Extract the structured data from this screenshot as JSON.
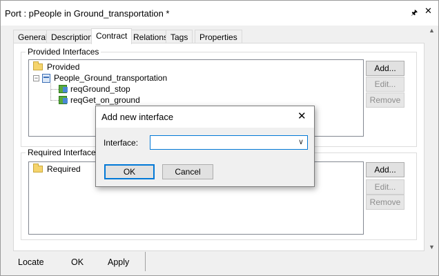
{
  "window": {
    "title": "Port : pPeople in Ground_transportation *",
    "pin_icon": "pin-icon",
    "close_icon": "close-icon"
  },
  "tabs": [
    {
      "label": "General"
    },
    {
      "label": "Description"
    },
    {
      "label": "Contract"
    },
    {
      "label": "Relations"
    },
    {
      "label": "Tags"
    },
    {
      "label": "Properties"
    }
  ],
  "active_tab": "Contract",
  "provided": {
    "group_label": "Provided Interfaces",
    "root_label": "Provided",
    "interface_label": "People_Ground_transportation",
    "operations": [
      "reqGround_stop",
      "reqGet_on_ground"
    ],
    "buttons": {
      "add": "Add...",
      "edit": "Edit...",
      "remove": "Remove"
    }
  },
  "required": {
    "group_label": "Required Interfaces",
    "root_label": "Required",
    "buttons": {
      "add": "Add...",
      "edit": "Edit...",
      "remove": "Remove"
    }
  },
  "bottom": {
    "locate": "Locate",
    "ok": "OK",
    "apply": "Apply"
  },
  "dialog": {
    "title": "Add new interface",
    "field_label": "Interface:",
    "field_value": "",
    "ok": "OK",
    "cancel": "Cancel"
  },
  "colors": {
    "accent": "#0078d7",
    "folder": "#f5d46d"
  }
}
